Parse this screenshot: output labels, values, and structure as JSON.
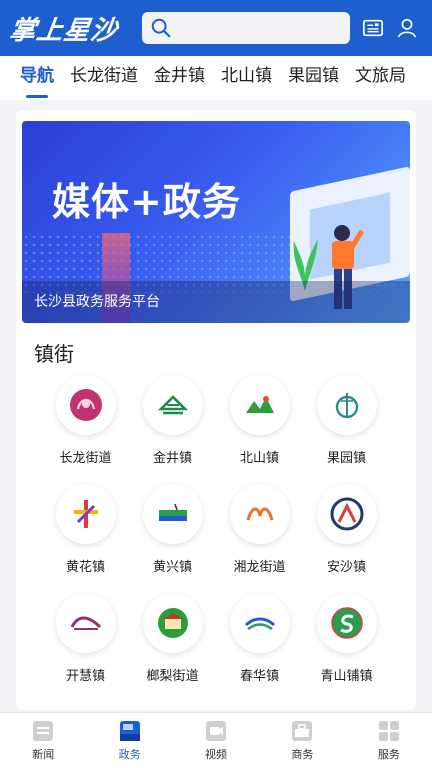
{
  "header": {
    "logo": "掌上星沙",
    "search_placeholder": ""
  },
  "tabs": [
    {
      "label": "导航",
      "active": true
    },
    {
      "label": "长龙街道",
      "active": false
    },
    {
      "label": "金井镇",
      "active": false
    },
    {
      "label": "北山镇",
      "active": false
    },
    {
      "label": "果园镇",
      "active": false
    },
    {
      "label": "文旅局",
      "active": false
    }
  ],
  "banner": {
    "title": "媒体+政务",
    "caption": "长沙县政务服务平台"
  },
  "section": {
    "title": "镇街"
  },
  "towns": [
    {
      "label": "长龙街道",
      "icon": "changlong-logo-icon"
    },
    {
      "label": "金井镇",
      "icon": "jinjing-logo-icon"
    },
    {
      "label": "北山镇",
      "icon": "beishan-logo-icon"
    },
    {
      "label": "果园镇",
      "icon": "guoyuan-logo-icon"
    },
    {
      "label": "黄花镇",
      "icon": "huanghua-logo-icon"
    },
    {
      "label": "黄兴镇",
      "icon": "huangxing-logo-icon"
    },
    {
      "label": "湘龙街道",
      "icon": "xianglong-logo-icon"
    },
    {
      "label": "安沙镇",
      "icon": "ansha-logo-icon"
    },
    {
      "label": "开慧镇",
      "icon": "kaihui-logo-icon"
    },
    {
      "label": "榔梨街道",
      "icon": "langli-logo-icon"
    },
    {
      "label": "春华镇",
      "icon": "chunhua-logo-icon"
    },
    {
      "label": "青山铺镇",
      "icon": "qingshanpu-logo-icon"
    }
  ],
  "bottom_nav": [
    {
      "label": "新闻",
      "icon": "news-icon",
      "active": false
    },
    {
      "label": "政务",
      "icon": "government-icon",
      "active": true
    },
    {
      "label": "视频",
      "icon": "video-icon",
      "active": false
    },
    {
      "label": "商务",
      "icon": "business-icon",
      "active": false
    },
    {
      "label": "服务",
      "icon": "services-icon",
      "active": false
    }
  ],
  "colors": {
    "brand": "#1e5fd0",
    "background": "#f3f4f8"
  }
}
